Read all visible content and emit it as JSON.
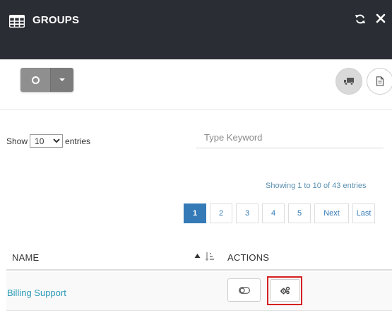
{
  "header": {
    "title": "GROUPS",
    "icon": "table-grid-icon",
    "actions": [
      "refresh-icon",
      "close-icon"
    ],
    "background": "#2a2d33"
  },
  "toolbar": {
    "split_button": {
      "icon": "circle-icon",
      "dropdown_icon": "caret-down-icon"
    },
    "right_buttons": [
      "truck-icon",
      "document-icon"
    ]
  },
  "controls": {
    "show_label": "Show",
    "entries_label": "entries",
    "page_size_selected": "10",
    "search_placeholder": "Type Keyword"
  },
  "info_text": "Showing 1 to 10 of 43 entries",
  "pagination": {
    "pages": [
      "1",
      "2",
      "3",
      "4",
      "5"
    ],
    "active_page": "1",
    "next_label": "Next",
    "last_label": "Last",
    "accent": "#337ab7"
  },
  "table": {
    "columns": [
      "NAME",
      "ACTIONS"
    ],
    "rows": [
      {
        "name": "Billing Support",
        "actions": [
          "toggle-icon",
          "settings-gears-icon"
        ]
      }
    ]
  },
  "highlight_color": "#d62020"
}
